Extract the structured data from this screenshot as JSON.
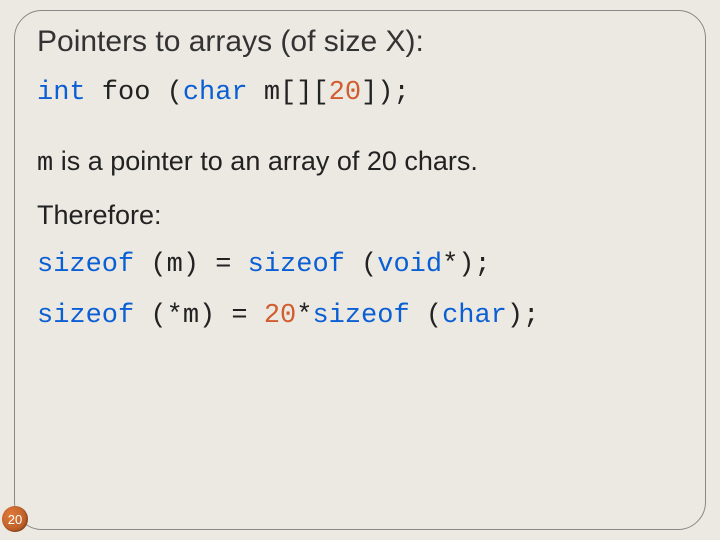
{
  "title": "Pointers to arrays (of size X):",
  "decl": {
    "kw_int": "int",
    "fn": " foo (",
    "kw_char": "char",
    "param": " m[][",
    "dim": "20",
    "tail": "]);"
  },
  "expl": {
    "mvar": "m",
    "rest": " is a pointer to an array of 20 chars."
  },
  "therefore": "Therefore:",
  "sz1": {
    "kw1": "sizeof",
    "mid1": " (m) = ",
    "kw2": "sizeof",
    "mid2": " (",
    "kw3": "void",
    "tail": "*);"
  },
  "sz2": {
    "kw1": "sizeof",
    "mid1": " (*m) = ",
    "num": "20",
    "star": "*",
    "kw2": "sizeof",
    "mid2": " (",
    "kw3": "char",
    "tail": ");"
  },
  "page": "20"
}
